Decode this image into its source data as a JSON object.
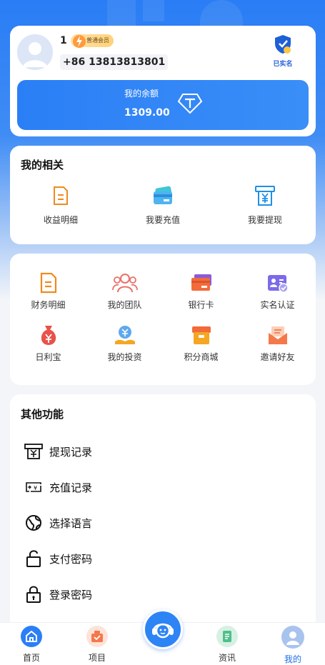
{
  "profile": {
    "username": "1",
    "vip_level": "普通会员",
    "phone": "+86 13813813801",
    "verified_label": "已实名"
  },
  "balance": {
    "label": "我的余额",
    "value": "1309.00"
  },
  "related": {
    "title": "我的相关",
    "items": [
      {
        "label": "收益明细",
        "icon": "earnings-doc-icon"
      },
      {
        "label": "我要充值",
        "icon": "recharge-card-icon"
      },
      {
        "label": "我要提现",
        "icon": "withdraw-atm-icon"
      }
    ]
  },
  "grid": {
    "items": [
      {
        "label": "财务明细",
        "icon": "finance-doc-icon"
      },
      {
        "label": "我的团队",
        "icon": "team-icon"
      },
      {
        "label": "银行卡",
        "icon": "bank-card-icon"
      },
      {
        "label": "实名认证",
        "icon": "id-verify-icon"
      },
      {
        "label": "日利宝",
        "icon": "money-bag-icon"
      },
      {
        "label": "我的投资",
        "icon": "investment-icon"
      },
      {
        "label": "积分商城",
        "icon": "points-mall-icon"
      },
      {
        "label": "邀请好友",
        "icon": "invite-envelope-icon"
      }
    ]
  },
  "other": {
    "title": "其他功能",
    "items": [
      {
        "label": "提现记录",
        "icon": "withdraw-record-icon"
      },
      {
        "label": "充值记录",
        "icon": "recharge-record-icon"
      },
      {
        "label": "选择语言",
        "icon": "globe-icon"
      },
      {
        "label": "支付密码",
        "icon": "unlock-icon"
      },
      {
        "label": "登录密码",
        "icon": "lock-icon"
      }
    ]
  },
  "nav": {
    "items": [
      {
        "label": "首页",
        "icon": "home-icon"
      },
      {
        "label": "项目",
        "icon": "project-bag-icon"
      },
      {
        "label": "资讯",
        "icon": "news-icon"
      },
      {
        "label": "我的",
        "icon": "profile-icon"
      }
    ],
    "active": "我的"
  },
  "colors": {
    "primary": "#2b7ff6",
    "active_nav": "#1f6fe8",
    "orange": "#f08a1c"
  }
}
